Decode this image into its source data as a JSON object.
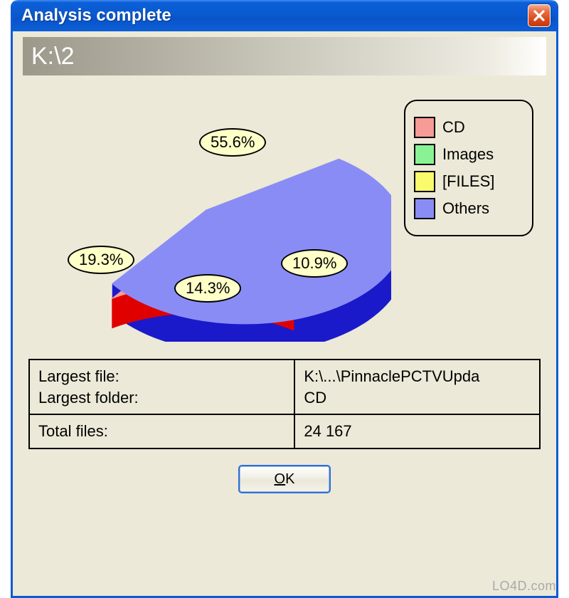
{
  "window": {
    "title": "Analysis complete",
    "path": "K:\\2"
  },
  "chart_data": {
    "type": "pie",
    "series": [
      {
        "name": "CD",
        "value": 19.3,
        "label": "19.3%",
        "color_top": "#f69b95",
        "color_side": "#e10000"
      },
      {
        "name": "Images",
        "value": 14.3,
        "label": "14.3%",
        "color_top": "#89f294",
        "color_side": "#00c400"
      },
      {
        "name": "[FILES]",
        "value": 10.9,
        "label": "10.9%",
        "color_top": "#fafb6c",
        "color_side": "#e0d500"
      },
      {
        "name": "Others",
        "value": 55.6,
        "label": "55.6%",
        "color_top": "#8a8cf6",
        "color_side": "#1a1acb"
      }
    ]
  },
  "legend": {
    "items": [
      {
        "label": "CD",
        "color": "#f69b95"
      },
      {
        "label": "Images",
        "color": "#89f294"
      },
      {
        "label": "[FILES]",
        "color": "#fafb6c"
      },
      {
        "label": "Others",
        "color": "#8a8cf6"
      }
    ]
  },
  "info": {
    "row1": {
      "labels": "Largest file:\nLargest folder:",
      "values": "K:\\...\\PinnaclePCTVUpda\nCD"
    },
    "row2": {
      "label": "Total files:",
      "value": "24 167"
    }
  },
  "buttons": {
    "ok": "OK"
  },
  "watermark": "LO4D.com"
}
